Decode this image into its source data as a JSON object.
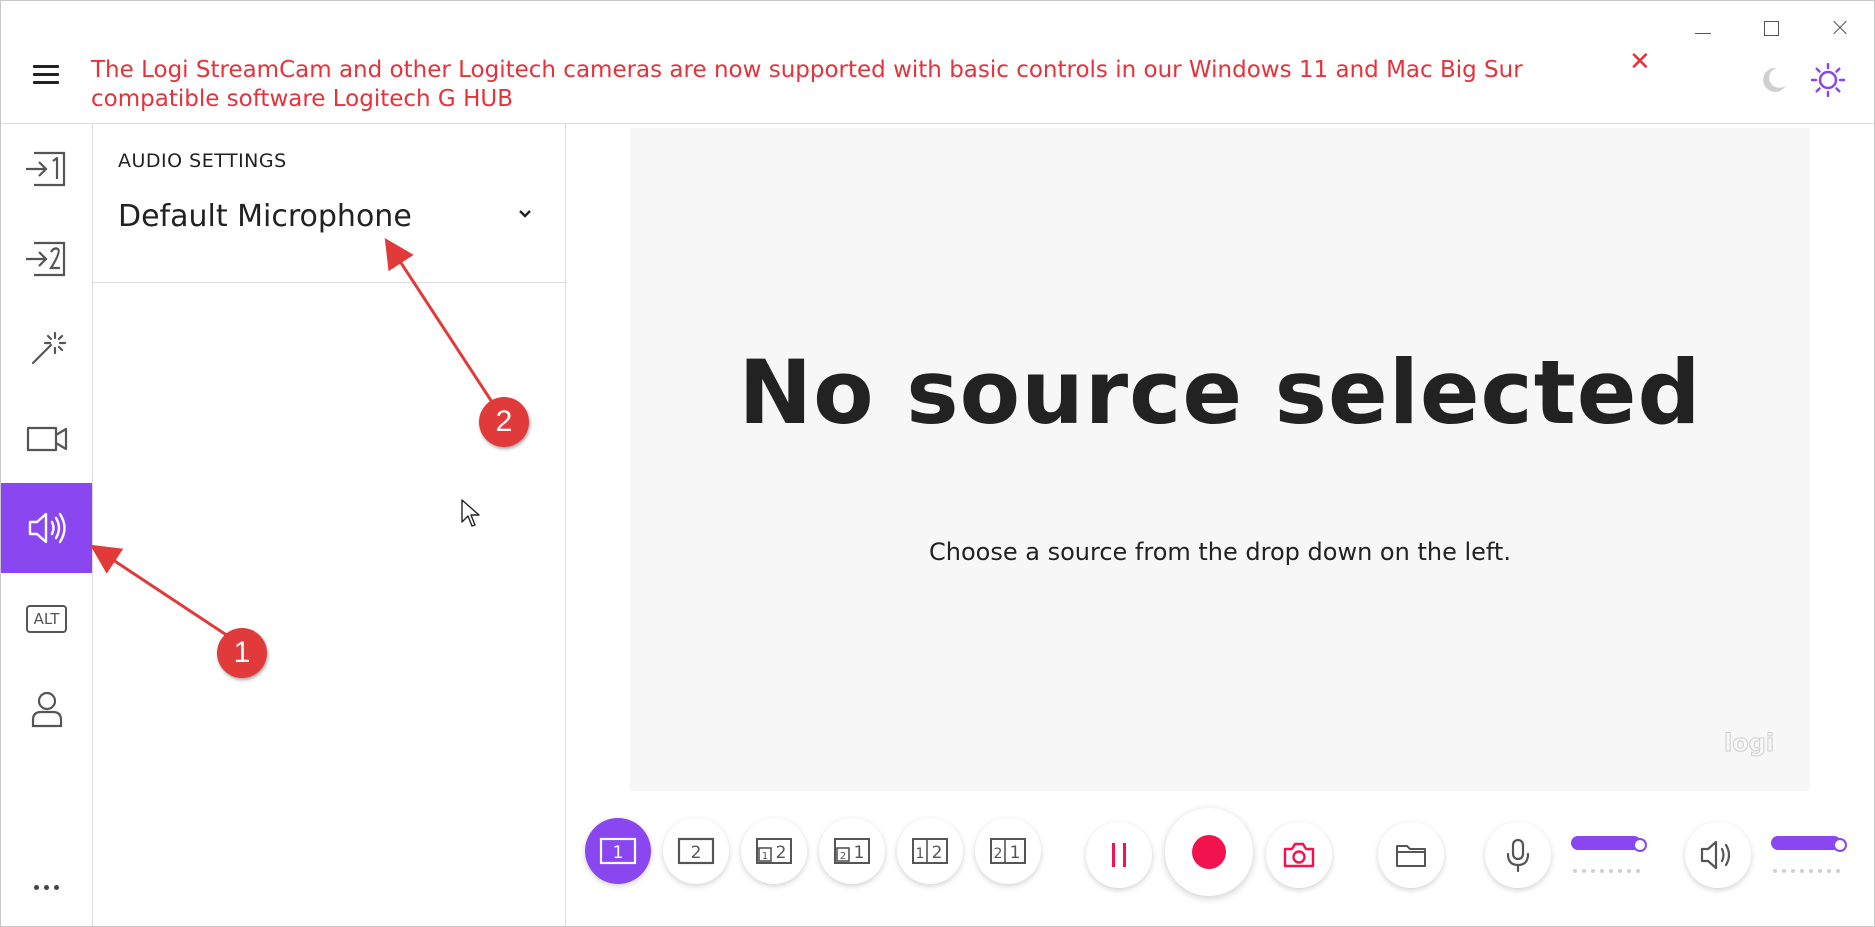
{
  "header": {
    "banner_text": "The Logi StreamCam and other Logitech cameras are now supported with basic controls in our Windows 11 and Mac Big Sur compatible software Logitech G HUB",
    "banner_close_icon": "close-icon",
    "window_controls": [
      "minimize-icon",
      "maximize-icon",
      "close-icon"
    ],
    "theme_icons": [
      "moon-icon",
      "sun-icon"
    ]
  },
  "rail": {
    "items": [
      {
        "name": "source-1",
        "icon": "input-1-icon"
      },
      {
        "name": "source-2",
        "icon": "input-2-icon"
      },
      {
        "name": "effects",
        "icon": "magic-wand-icon"
      },
      {
        "name": "video",
        "icon": "camera-icon"
      },
      {
        "name": "audio",
        "icon": "speaker-icon",
        "active": true
      },
      {
        "name": "alt",
        "icon": "alt-icon",
        "label": "ALT"
      },
      {
        "name": "account",
        "icon": "user-icon"
      }
    ],
    "more_icon": "more-dots-icon"
  },
  "panel": {
    "title": "AUDIO SETTINGS",
    "microphone_selected": "Default Microphone"
  },
  "preview": {
    "title": "No source selected",
    "hint": "Choose a source from the drop down on the left.",
    "watermark": "logi"
  },
  "toolbar": {
    "layouts": [
      "1",
      "2",
      "1 2",
      "2 1",
      "1 2",
      "2 1"
    ],
    "selected_layout_index": 0,
    "actions": [
      "pause-icon",
      "record-icon",
      "snapshot-icon",
      "folder-icon"
    ],
    "mic_level": 0.85,
    "speaker_level": 0.85
  },
  "colors": {
    "accent": "#8a47f0",
    "banner": "#e5323b",
    "record": "#f2124d",
    "annotation": "#e03a3a"
  },
  "annotations": {
    "badge_1": "1",
    "badge_2": "2"
  }
}
